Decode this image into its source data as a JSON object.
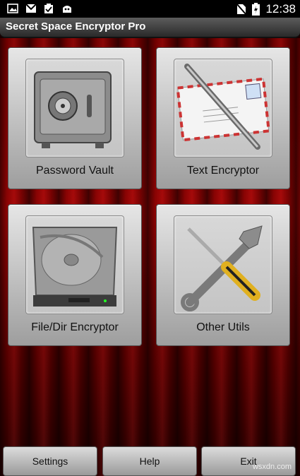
{
  "status_bar": {
    "time": "12:38"
  },
  "title_bar": {
    "title": "Secret Space Encryptor Pro"
  },
  "tiles": [
    {
      "label": "Password Vault"
    },
    {
      "label": "Text Encryptor"
    },
    {
      "label": "File/Dir Encryptor"
    },
    {
      "label": "Other Utils"
    }
  ],
  "buttons": {
    "settings": "Settings",
    "help": "Help",
    "exit": "Exit"
  },
  "watermark": "wsxdn.com"
}
